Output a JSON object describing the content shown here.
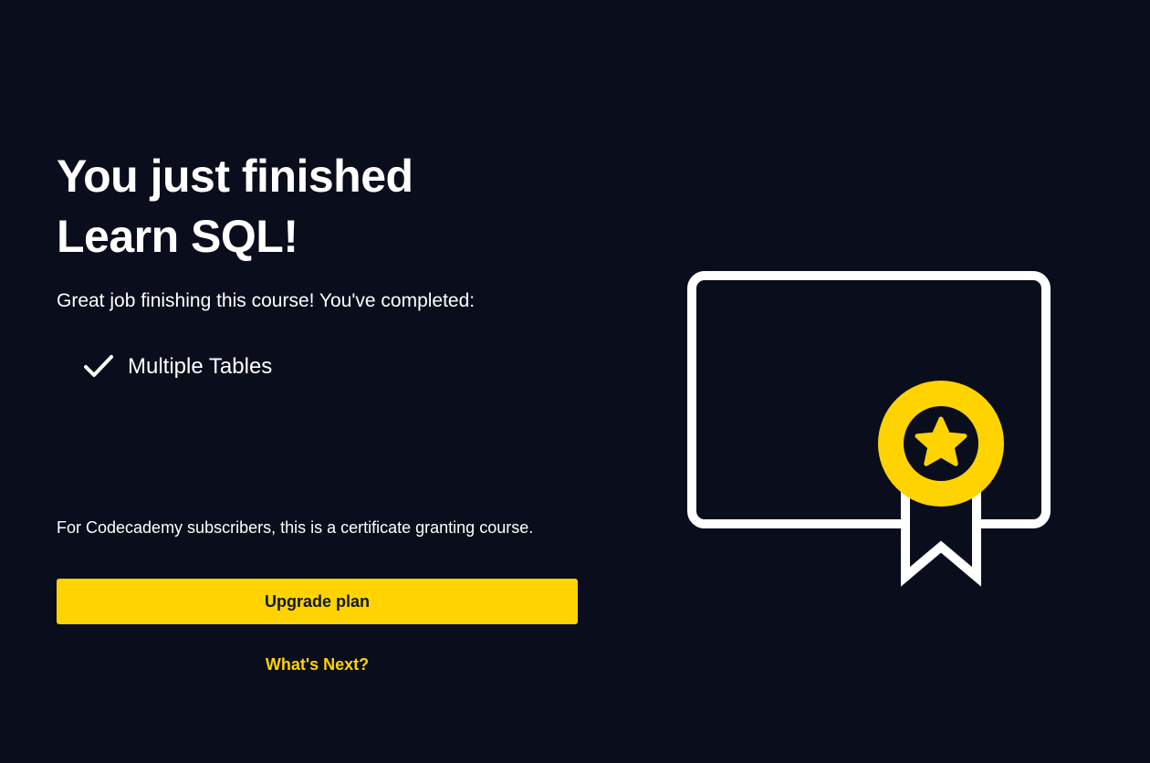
{
  "headline": {
    "line1": "You just finished",
    "line2": "Learn SQL!"
  },
  "intro": "Great job finishing this course! You've completed:",
  "completed": [
    {
      "label": "Multiple Tables",
      "icon": "check-icon"
    }
  ],
  "subscribers_note": "For Codecademy subscribers, this is a certificate granting course.",
  "upgrade_button": "Upgrade plan",
  "whats_next_link": "What's Next?",
  "colors": {
    "background": "#0a0d1c",
    "accent": "#ffd300",
    "text": "#ffffff",
    "button_text": "#10162f"
  },
  "illustration": {
    "icon": "certificate-icon",
    "badge_icon": "star-icon"
  }
}
